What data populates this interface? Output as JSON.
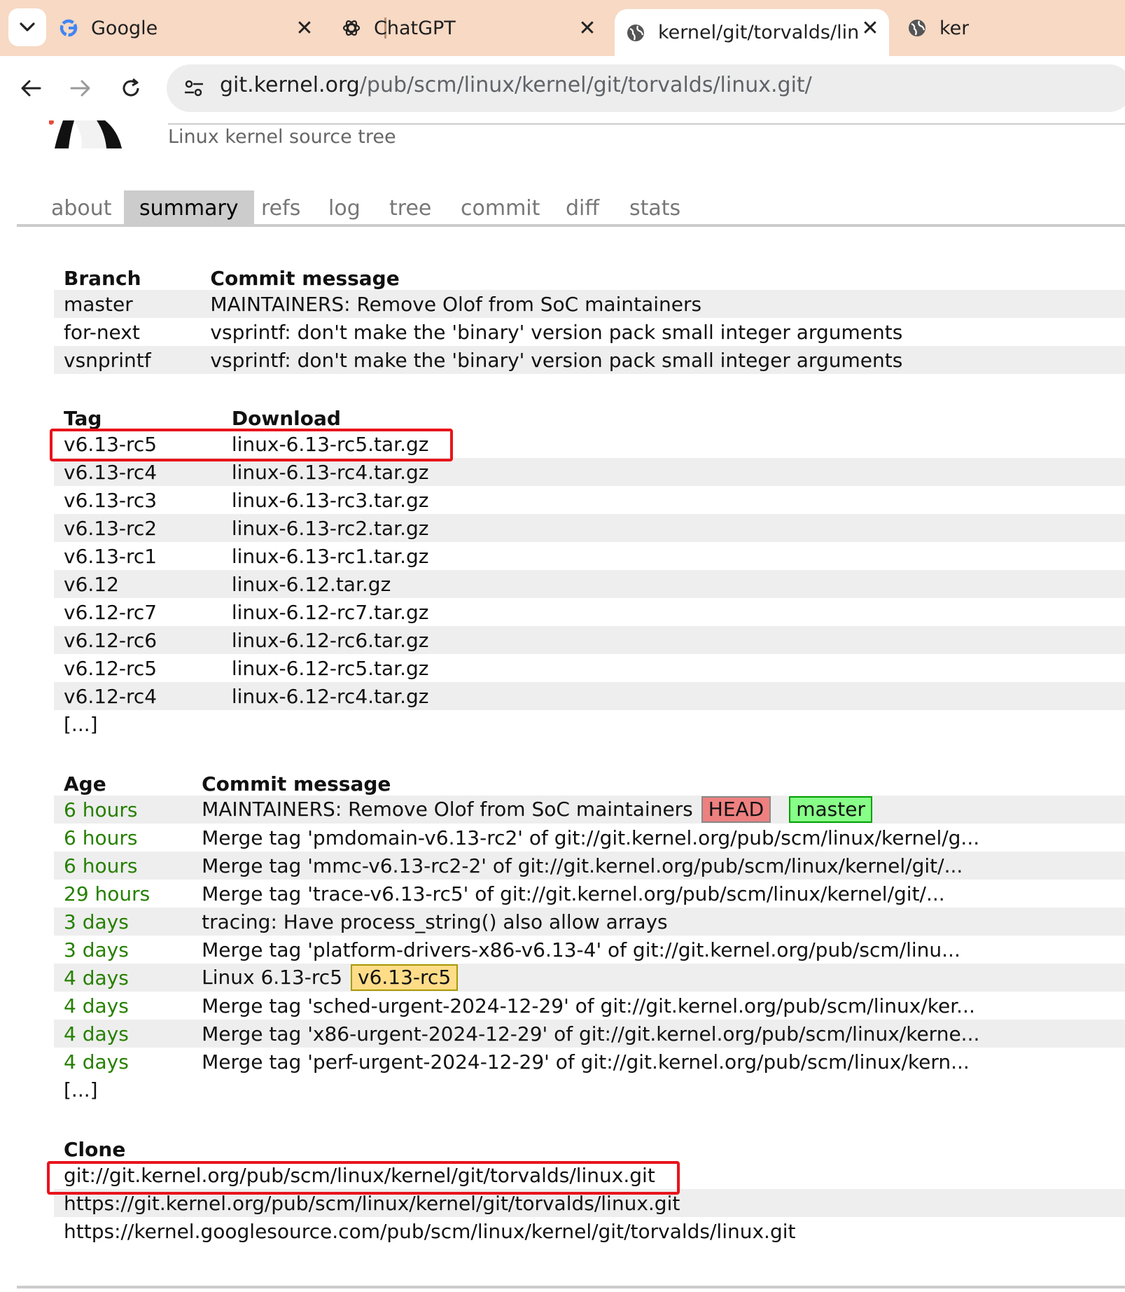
{
  "browser": {
    "tabs": [
      {
        "title": "Google",
        "icon": "google-g-icon"
      },
      {
        "title": "ChatGPT",
        "icon": "chatgpt-icon"
      },
      {
        "title": "kernel/git/torvalds/linux.git - ",
        "icon": "globe-icon",
        "active": true
      },
      {
        "title": "ker",
        "icon": "globe-icon"
      }
    ],
    "url_host": "git.kernel.org",
    "url_path": "/pub/scm/linux/kernel/git/torvalds/linux.git/"
  },
  "header": {
    "description": "Linux kernel source tree"
  },
  "nav": [
    "about",
    "summary",
    "refs",
    "log",
    "tree",
    "commit",
    "diff",
    "stats"
  ],
  "branches": {
    "headers": [
      "Branch",
      "Commit message"
    ],
    "rows": [
      {
        "name": "master",
        "message": "MAINTAINERS: Remove Olof from SoC maintainers"
      },
      {
        "name": "for-next",
        "message": "vsprintf: don't make the 'binary' version pack small integer arguments"
      },
      {
        "name": "vsnprintf",
        "message": "vsprintf: don't make the 'binary' version pack small integer arguments"
      }
    ]
  },
  "tags": {
    "headers": [
      "Tag",
      "Download"
    ],
    "rows": [
      {
        "tag": "v6.13-rc5",
        "file": "linux-6.13-rc5.tar.gz"
      },
      {
        "tag": "v6.13-rc4",
        "file": "linux-6.13-rc4.tar.gz"
      },
      {
        "tag": "v6.13-rc3",
        "file": "linux-6.13-rc3.tar.gz"
      },
      {
        "tag": "v6.13-rc2",
        "file": "linux-6.13-rc2.tar.gz"
      },
      {
        "tag": "v6.13-rc1",
        "file": "linux-6.13-rc1.tar.gz"
      },
      {
        "tag": "v6.12",
        "file": "linux-6.12.tar.gz"
      },
      {
        "tag": "v6.12-rc7",
        "file": "linux-6.12-rc7.tar.gz"
      },
      {
        "tag": "v6.12-rc6",
        "file": "linux-6.12-rc6.tar.gz"
      },
      {
        "tag": "v6.12-rc5",
        "file": "linux-6.12-rc5.tar.gz"
      },
      {
        "tag": "v6.12-rc4",
        "file": "linux-6.12-rc4.tar.gz"
      }
    ],
    "more": "[...]"
  },
  "commits": {
    "headers": [
      "Age",
      "Commit message"
    ],
    "rows": [
      {
        "age": "6 hours",
        "message": "MAINTAINERS: Remove Olof from SoC maintainers",
        "decos": [
          {
            "text": "HEAD",
            "kind": "head"
          },
          {
            "text": "master",
            "kind": "branch"
          }
        ]
      },
      {
        "age": "6 hours",
        "message": "Merge tag 'pmdomain-v6.13-rc2' of git://git.kernel.org/pub/scm/linux/kernel/g..."
      },
      {
        "age": "6 hours",
        "message": "Merge tag 'mmc-v6.13-rc2-2' of git://git.kernel.org/pub/scm/linux/kernel/git/..."
      },
      {
        "age": "29 hours",
        "message": "Merge tag 'trace-v6.13-rc5' of git://git.kernel.org/pub/scm/linux/kernel/git/..."
      },
      {
        "age": "3 days",
        "message": "tracing: Have process_string() also allow arrays"
      },
      {
        "age": "3 days",
        "message": "Merge tag 'platform-drivers-x86-v6.13-4' of git://git.kernel.org/pub/scm/linu..."
      },
      {
        "age": "4 days",
        "message": "Linux 6.13-rc5",
        "decos": [
          {
            "text": "v6.13-rc5",
            "kind": "tagd"
          }
        ]
      },
      {
        "age": "4 days",
        "message": "Merge tag 'sched-urgent-2024-12-29' of git://git.kernel.org/pub/scm/linux/ker..."
      },
      {
        "age": "4 days",
        "message": "Merge tag 'x86-urgent-2024-12-29' of git://git.kernel.org/pub/scm/linux/kerne..."
      },
      {
        "age": "4 days",
        "message": "Merge tag 'perf-urgent-2024-12-29' of git://git.kernel.org/pub/scm/linux/kern..."
      }
    ],
    "more": "[...]"
  },
  "clone": {
    "header": "Clone",
    "urls": [
      "git://git.kernel.org/pub/scm/linux/kernel/git/torvalds/linux.git",
      "https://git.kernel.org/pub/scm/linux/kernel/git/torvalds/linux.git",
      "https://kernel.googlesource.com/pub/scm/linux/kernel/git/torvalds/linux.git"
    ]
  },
  "colors": {
    "tabstrip": "#f7d9c4",
    "age_green": "#268000",
    "highlight_red": "#e8141b",
    "head_badge": "#ee8080",
    "branch_badge": "#88ff88",
    "tag_badge": "#ffdd88"
  }
}
